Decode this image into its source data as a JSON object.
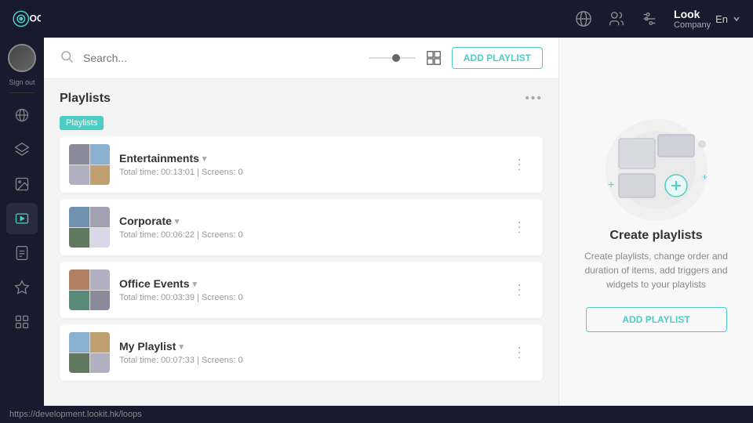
{
  "topbar": {
    "title": "LOOK",
    "user": {
      "name": "Look",
      "company": "Company",
      "lang": "En"
    }
  },
  "sidebar": {
    "sign_out_label": "Sign out",
    "items": [
      {
        "id": "globe",
        "label": "Globe"
      },
      {
        "id": "layers",
        "label": "Layers"
      },
      {
        "id": "image",
        "label": "Image"
      },
      {
        "id": "playlists",
        "label": "Playlists",
        "active": true
      },
      {
        "id": "document",
        "label": "Document"
      },
      {
        "id": "star",
        "label": "Star"
      },
      {
        "id": "apps",
        "label": "Apps"
      }
    ]
  },
  "search": {
    "placeholder": "Search..."
  },
  "toolbar": {
    "add_playlist_label": "ADD PLAYLIST"
  },
  "playlists_section": {
    "title": "Playlists",
    "more_icon": "•••",
    "items": [
      {
        "id": "entertainments",
        "name": "Entertainments",
        "total_time": "Total time: 00:13:01",
        "screens": "Screens: 0",
        "meta": "Total time: 00:13:01  |  Screens: 0"
      },
      {
        "id": "corporate",
        "name": "Corporate",
        "total_time": "Total time: 00:06:22",
        "screens": "Screens: 0",
        "meta": "Total time: 00:06:22  |  Screens: 0"
      },
      {
        "id": "office-events",
        "name": "Office Events",
        "total_time": "Total time: 00:03:39",
        "screens": "Screens: 0",
        "meta": "Total time: 00:03:39  |  Screens: 0"
      },
      {
        "id": "my-playlist",
        "name": "My Playlist",
        "total_time": "Total time: 00:07:33",
        "screens": "Screens: 0",
        "meta": "Total time: 00:07:33  |  Screens: 0"
      }
    ]
  },
  "right_panel": {
    "title": "Create playlists",
    "description": "Create playlists, change order and duration of items, add triggers and widgets to your playlists",
    "add_label": "ADD PLAYLIST"
  },
  "statusbar": {
    "url": "https://development.lookit.hk/loops"
  },
  "tooltip": {
    "playlists_label": "Playlists"
  }
}
